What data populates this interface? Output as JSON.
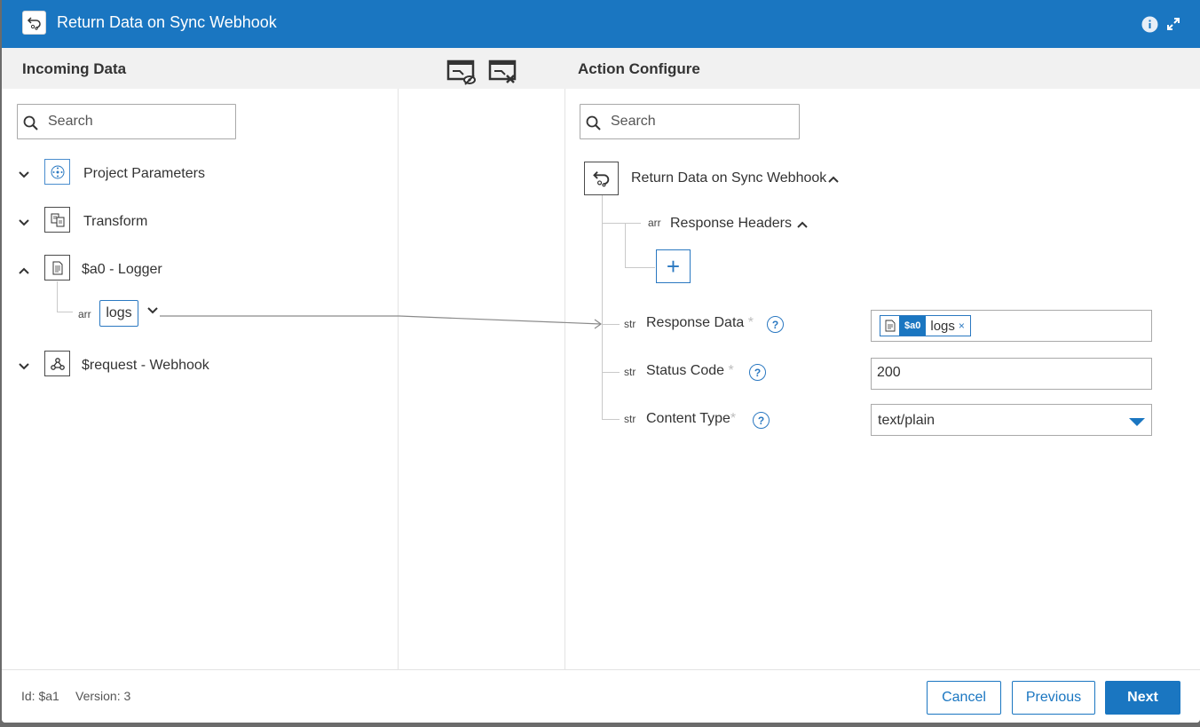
{
  "dialog": {
    "title": "Return Data on Sync Webhook"
  },
  "incoming": {
    "title": "Incoming Data",
    "search_placeholder": "Search",
    "nodes": [
      {
        "label": "Project Parameters",
        "expanded": false,
        "icon": "project-parameters-icon"
      },
      {
        "label": "Transform",
        "expanded": false,
        "icon": "transform-icon"
      },
      {
        "label": "$a0 - Logger",
        "expanded": true,
        "icon": "logger-icon",
        "children": [
          {
            "type": "arr",
            "label": "logs"
          }
        ]
      },
      {
        "label": "$request - Webhook",
        "expanded": false,
        "icon": "webhook-icon"
      }
    ]
  },
  "action": {
    "title": "Action Configure",
    "search_placeholder": "Search",
    "root_label": "Return Data on Sync Webhook",
    "headers": {
      "type": "arr",
      "label": "Response Headers",
      "add_label": "+"
    },
    "fields": [
      {
        "type": "str",
        "label": "Response Data",
        "required": "*",
        "help": "?",
        "chip": {
          "var": "$a0",
          "name": "logs",
          "remove": "×"
        }
      },
      {
        "type": "str",
        "label": "Status Code",
        "required": "*",
        "help": "?",
        "value": "200"
      },
      {
        "type": "str",
        "label": "Content Type",
        "required": "*",
        "help": "?",
        "value": "text/plain"
      }
    ]
  },
  "footer": {
    "id_label": "Id: $a1",
    "version_label": "Version: 3",
    "cancel": "Cancel",
    "previous": "Previous",
    "next": "Next"
  },
  "colors": {
    "primary": "#1a76c1",
    "header_bg": "#1a76c1",
    "subbar_bg": "#f1f1f1"
  }
}
